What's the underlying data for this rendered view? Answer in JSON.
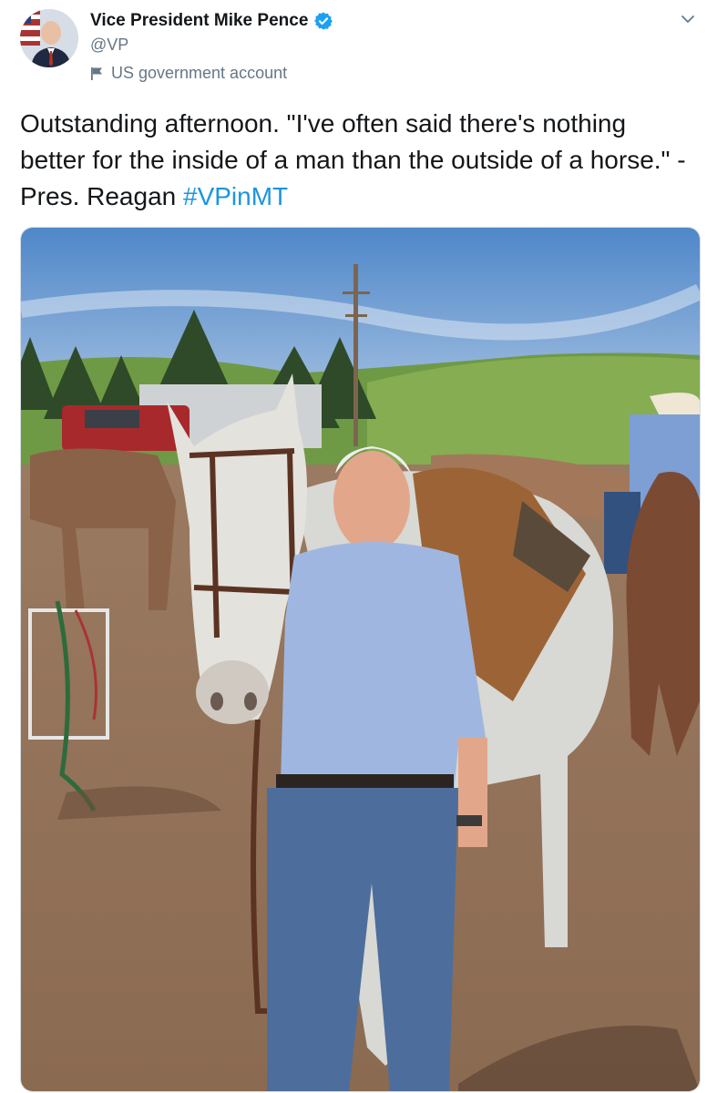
{
  "tweet": {
    "author_name": "Vice President Mike Pence",
    "handle": "@VP",
    "account_label": "US government account",
    "text": "Outstanding afternoon. \"I've often said there's nothing better for the inside of a man than the outside of a horse.\" -Pres. Reagan ",
    "hashtag": "#VPinMT",
    "icons": [
      "verified-badge-icon",
      "flag-icon",
      "chevron-down-icon"
    ],
    "colors": {
      "link": "#1b95e0",
      "verified": "#1da1f2",
      "secondary_text": "#657786"
    }
  }
}
